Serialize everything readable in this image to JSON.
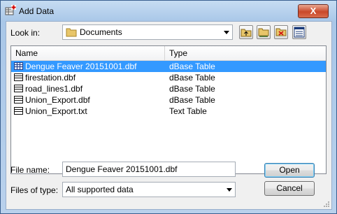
{
  "window": {
    "title": "Add Data",
    "close_label": "X"
  },
  "lookin": {
    "label": "Look in:",
    "value": "Documents"
  },
  "toolbar": [
    "up-one-level",
    "connect-folder",
    "disconnect-folder",
    "view-options"
  ],
  "columns": {
    "name": "Name",
    "type": "Type"
  },
  "files": [
    {
      "name": "Dengue Feaver 20151001.dbf",
      "type": "dBase Table",
      "selected": true
    },
    {
      "name": "firestation.dbf",
      "type": "dBase Table",
      "selected": false
    },
    {
      "name": "road_lines1.dbf",
      "type": "dBase Table",
      "selected": false
    },
    {
      "name": "Union_Export.dbf",
      "type": "dBase Table",
      "selected": false
    },
    {
      "name": "Union_Export.txt",
      "type": "Text Table",
      "selected": false
    }
  ],
  "filename": {
    "label": "File name:",
    "value": "Dengue Feaver 20151001.dbf"
  },
  "filetype": {
    "label": "Files of type:",
    "value": "All supported data"
  },
  "buttons": {
    "open": "Open",
    "cancel": "Cancel"
  }
}
